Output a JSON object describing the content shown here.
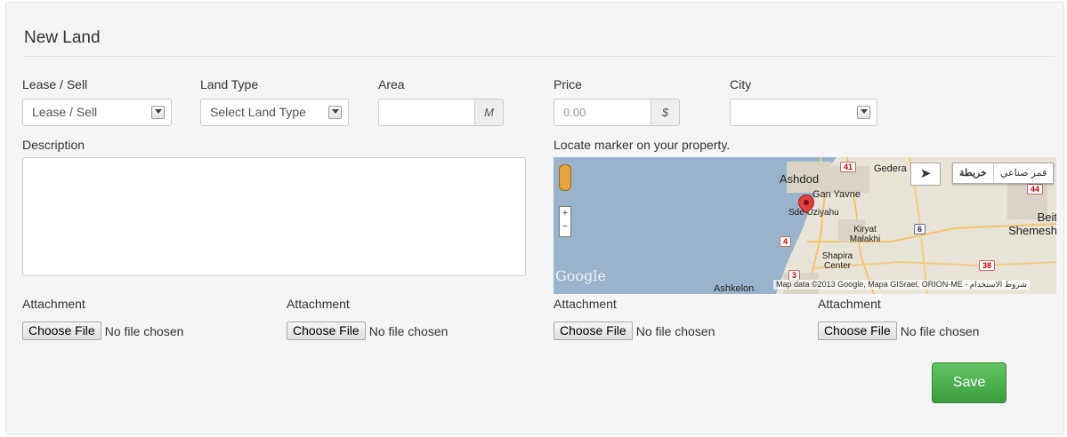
{
  "form": {
    "title": "New Land",
    "lease_sell": {
      "label": "Lease / Sell",
      "value": "Lease / Sell"
    },
    "land_type": {
      "label": "Land Type",
      "value": "Select Land Type"
    },
    "area": {
      "label": "Area",
      "value": "",
      "unit": "M"
    },
    "price": {
      "label": "Price",
      "placeholder": "0.00",
      "unit": "$"
    },
    "city": {
      "label": "City",
      "value": ""
    },
    "description": {
      "label": "Description",
      "value": ""
    },
    "map_label": "Locate marker on your property.",
    "attachments": [
      {
        "label": "Attachment",
        "button": "Choose File",
        "status": "No file chosen"
      },
      {
        "label": "Attachment",
        "button": "Choose File",
        "status": "No file chosen"
      },
      {
        "label": "Attachment",
        "button": "Choose File",
        "status": "No file chosen"
      },
      {
        "label": "Attachment",
        "button": "Choose File",
        "status": "No file chosen"
      }
    ],
    "save_label": "Save"
  },
  "map": {
    "map_types": [
      "خريطة",
      "قمر صناعي"
    ],
    "places": [
      "Ashdod",
      "Gedera",
      "Gan Yavne",
      "Sde Uziyahu",
      "Kiryat Malakhi",
      "Beit Shemesh",
      "Shapira Center",
      "Ashkelon"
    ],
    "roads": [
      "41",
      "44",
      "6",
      "4",
      "38",
      "3"
    ],
    "logo": "Google",
    "attribution": "Map data ©2013 Google, Mapa GISrael, ORION-ME - شروط الاستخدام"
  },
  "colors": {
    "panel_bg": "#f5f5f5",
    "save_green": "#4cae4c",
    "sea": "#99b3cc",
    "land": "#e8e4d8"
  }
}
